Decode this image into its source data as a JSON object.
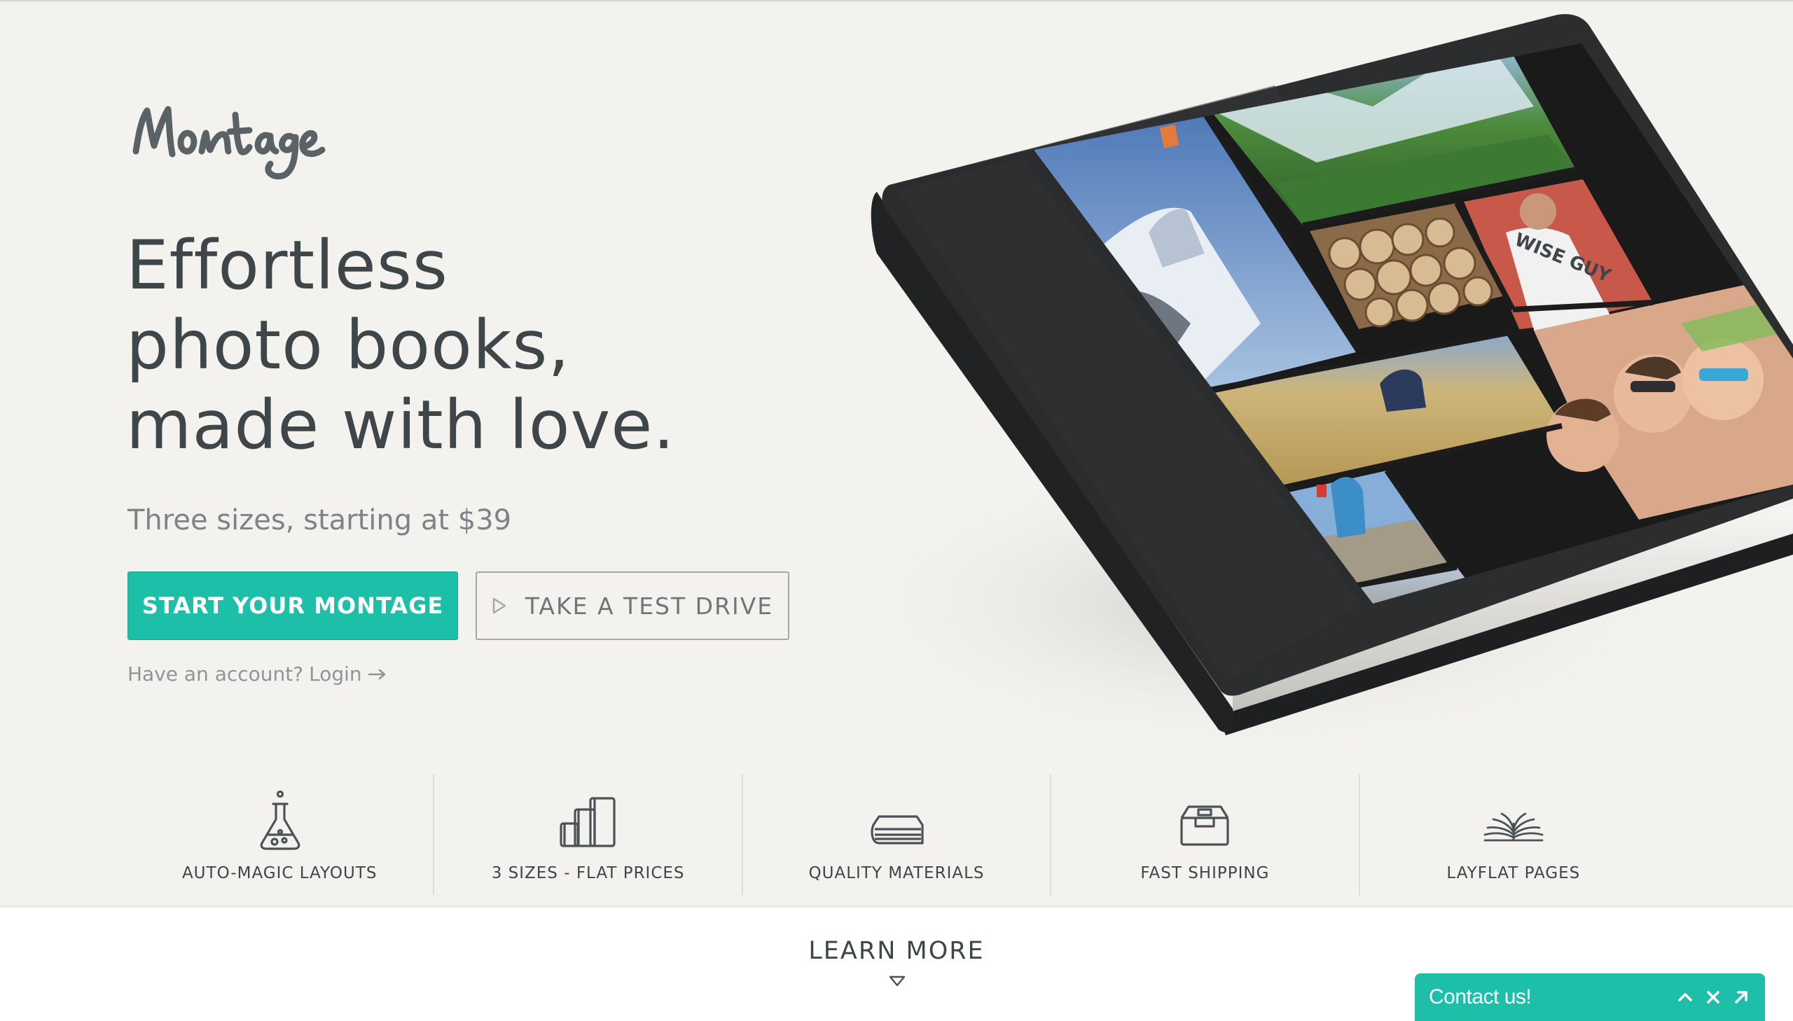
{
  "brand": {
    "logo_text": "Montage",
    "accent_color": "#1dbfa9"
  },
  "hero": {
    "headline_line1": "Effortless",
    "headline_line2": "photo books,",
    "headline_line3": "made with love.",
    "subhead": "Three sizes, starting at $39",
    "primary_cta": "START YOUR MONTAGE",
    "secondary_cta": "TAKE A TEST DRIVE",
    "account_prompt": "Have an account?",
    "login_label": "Login"
  },
  "book": {
    "shirt_text": "WISE GUY"
  },
  "features": [
    {
      "label": "AUTO-MAGIC LAYOUTS",
      "icon": "flask-icon"
    },
    {
      "label": "3 SIZES - FLAT PRICES",
      "icon": "book-sizes-icon"
    },
    {
      "label": "QUALITY MATERIALS",
      "icon": "book-stack-icon"
    },
    {
      "label": "FAST SHIPPING",
      "icon": "package-icon"
    },
    {
      "label": "LAYFLAT PAGES",
      "icon": "open-book-icon"
    }
  ],
  "footer": {
    "learn_more": "LEARN MORE"
  },
  "contact_widget": {
    "label": "Contact us!"
  }
}
